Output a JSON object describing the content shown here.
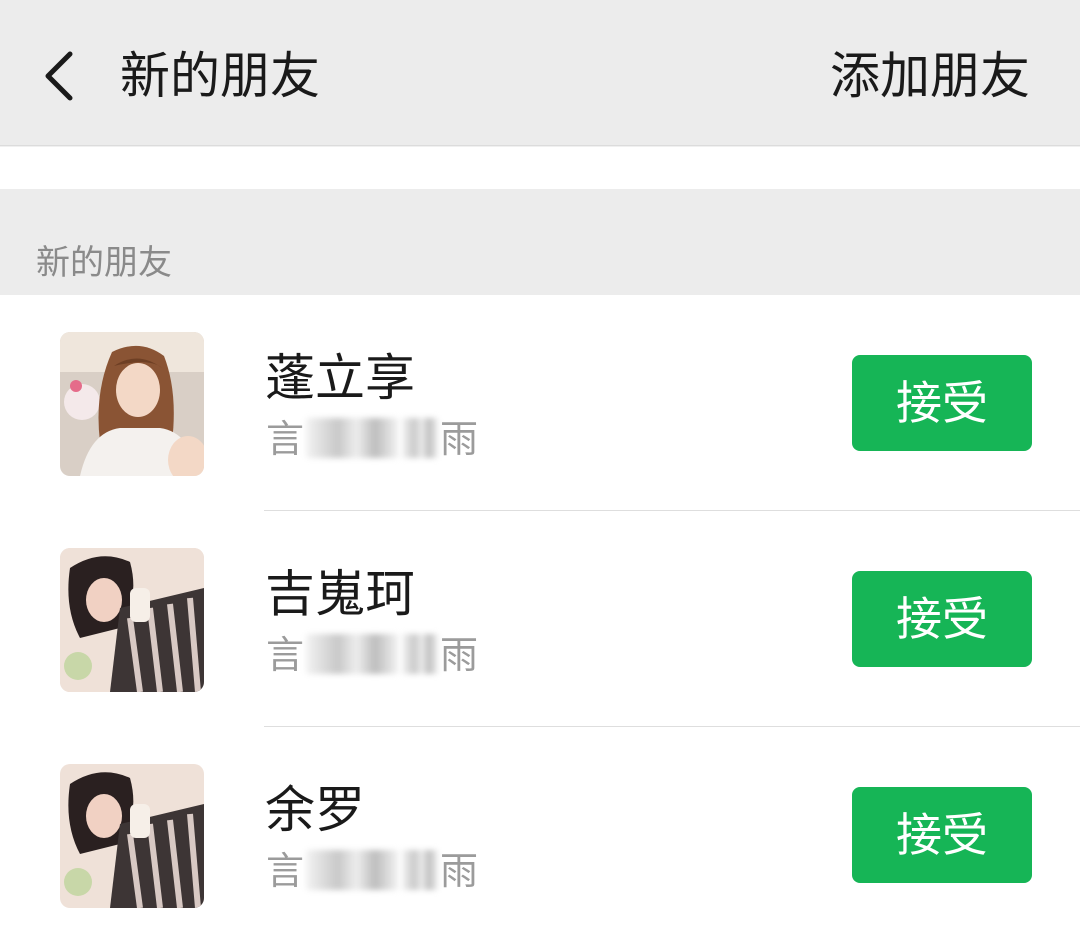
{
  "nav": {
    "title": "新的朋友",
    "action_label": "添加朋友"
  },
  "section": {
    "title": "新的朋友"
  },
  "friends": [
    {
      "name": "蓬立享",
      "msg_prefix": "言",
      "msg_suffix": "雨",
      "accept_label": "接受"
    },
    {
      "name": "吉嵬珂",
      "msg_prefix": "言",
      "msg_suffix": "雨",
      "accept_label": "接受"
    },
    {
      "name": "余罗",
      "msg_prefix": "言",
      "msg_suffix": "雨",
      "accept_label": "接受"
    }
  ],
  "colors": {
    "accent": "#16b556",
    "nav_bg": "#ececec",
    "secondary_text": "#9b9b9b"
  },
  "icons": {
    "back": "chevron-left-icon"
  }
}
